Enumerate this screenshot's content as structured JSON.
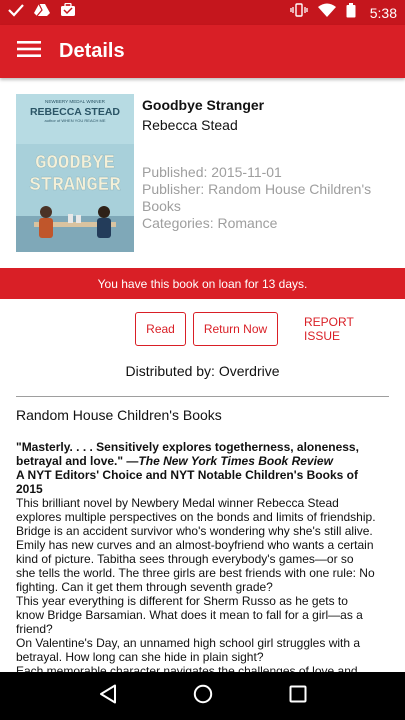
{
  "status_bar": {
    "time": "5:38",
    "colors": {
      "background": "#c5161d"
    },
    "icons": [
      "check-icon",
      "drive-icon",
      "briefcase-icon",
      "vibrate-icon",
      "wifi-icon",
      "battery-icon"
    ]
  },
  "app_bar": {
    "title": "Details",
    "menu_icon": "hamburger-menu-icon",
    "colors": {
      "background": "#d91f26",
      "text": "#ffffff"
    }
  },
  "book": {
    "title": "Goodbye Stranger",
    "author": "Rebecca Stead",
    "published": "Published: 2015-11-01",
    "publisher": "Publisher: Random House Children's Books",
    "categories": "Categories: Romance",
    "cover": {
      "badge": "NEWBERY MEDAL WINNER",
      "author": "REBECCA STEAD",
      "subtitle": "author of WHEN YOU REACH ME",
      "title_line1": "GOODBYE",
      "title_line2": "STRANGER"
    }
  },
  "loan": {
    "message": "You have this book on loan for 13 days."
  },
  "actions": {
    "read_label": "Read",
    "return_label": "Return Now",
    "report_label": "REPORT ISSUE"
  },
  "distributed_by": "Distributed by: Overdrive",
  "publisher_name": "Random House Children's Books",
  "description": {
    "quote": "\"Masterly. . . . Sensitively explores togetherness, aloneness, betrayal and love.\"",
    "quote_dash": " —",
    "quote_source": "The New York Times Book Review",
    "awards": "A NYT Editors' Choice and NYT Notable Children's Books of 2015",
    "p1": "This brilliant novel by Newbery Medal winner Rebecca Stead explores multiple perspectives on the bonds and limits of friendship.",
    "p2": "Bridge is an accident survivor who's wondering why she's still alive. Emily has new curves and an almost-boyfriend who wants a certain kind of picture. Tabitha sees through everybody's games—or so she tells the world. The three girls are best friends with one rule: No fighting. Can it get them through seventh grade?",
    "p3": "This year everything is different for Sherm Russo as he gets to know Bridge Barsamian. What does it mean to fall for a girl—as a friend?",
    "p4": "On Valentine's Day, an unnamed high school girl struggles with a betrayal. How long can she hide in plain sight?",
    "p5": "Each memorable character navigates the challenges of love and..."
  },
  "nav_bar": {
    "icons": [
      "back-icon",
      "home-icon",
      "recents-icon"
    ]
  }
}
